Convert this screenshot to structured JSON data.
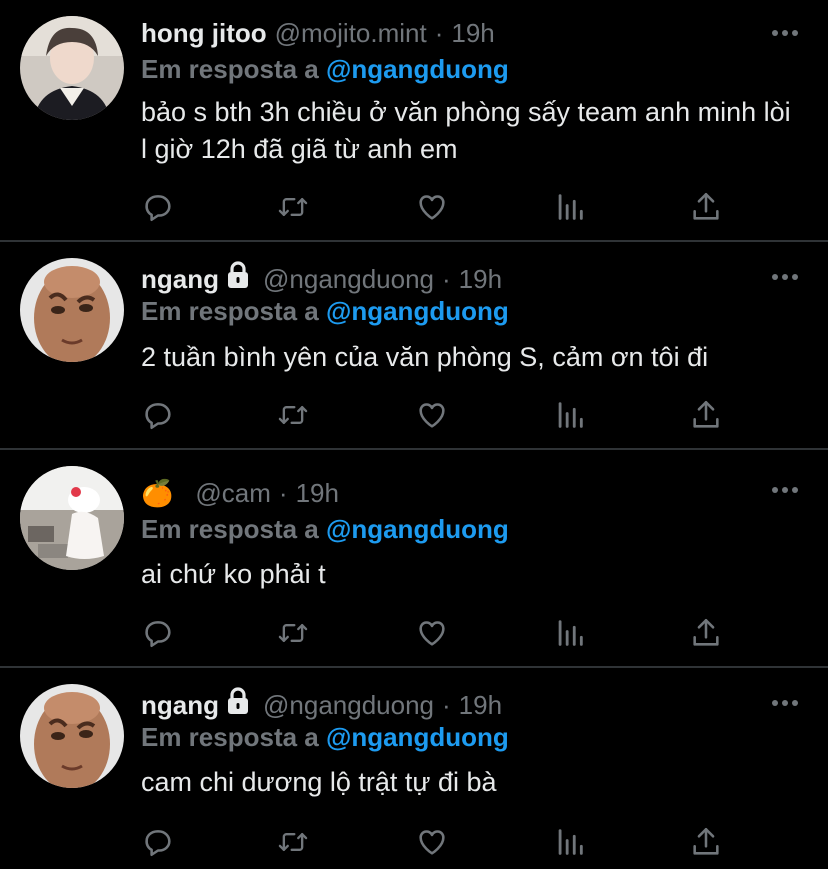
{
  "reply_prefix": "Em resposta a",
  "colors": {
    "background": "#000000",
    "text": "#e7e9ea",
    "muted": "#71767b",
    "mention": "#1d9bf0",
    "divider": "#2f3336"
  },
  "icons": {
    "reply": "comment-icon",
    "retweet": "retweet-icon",
    "like": "heart-icon",
    "views": "views-chart-icon",
    "share": "share-icon",
    "more": "more-dots-icon",
    "lock": "lock-icon"
  },
  "tweets": [
    {
      "name": "hong jitoo",
      "locked": false,
      "handle": "@mojito.mint",
      "time": "19h",
      "mention": "@ngangduong",
      "text": "bảo s bth 3h chiều ở văn phòng sấy team anh minh lòi l giờ 12h đã giã từ anh em"
    },
    {
      "name": "ngang",
      "locked": true,
      "handle": "@ngangduong",
      "time": "19h",
      "mention": "@ngangduong",
      "text": "2 tuần bình yên của văn phòng S, cảm ơn tôi đi"
    },
    {
      "name": "🍊",
      "locked": false,
      "handle": "@cam",
      "time": "19h",
      "mention": "@ngangduong",
      "text": "ai chứ ko phải t"
    },
    {
      "name": "ngang",
      "locked": true,
      "handle": "@ngangduong",
      "time": "19h",
      "mention": "@ngangduong",
      "text": "cam chi dương lộ trật tự đi bà"
    }
  ]
}
